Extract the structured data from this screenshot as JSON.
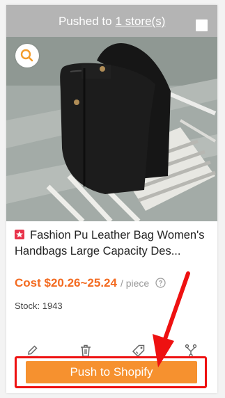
{
  "header": {
    "pushed_prefix": "Pushed to",
    "pushed_link": "1 store(s)"
  },
  "product": {
    "title": "Fashion Pu Leather Bag Women's Handbags Large Capacity Des...",
    "price": "Cost $20.26~25.24",
    "unit": "/ piece",
    "stock": "Stock: 1943"
  },
  "actions": {
    "icons": [
      "pencil-icon",
      "trash-icon",
      "tag-icon",
      "split-icon"
    ]
  },
  "push_button": {
    "label": "Push to Shopify"
  },
  "colors": {
    "accent": "#f6912f",
    "price": "#f36b21",
    "highlight": "#ee1111",
    "pushed_bar": "#b4b4b4"
  }
}
